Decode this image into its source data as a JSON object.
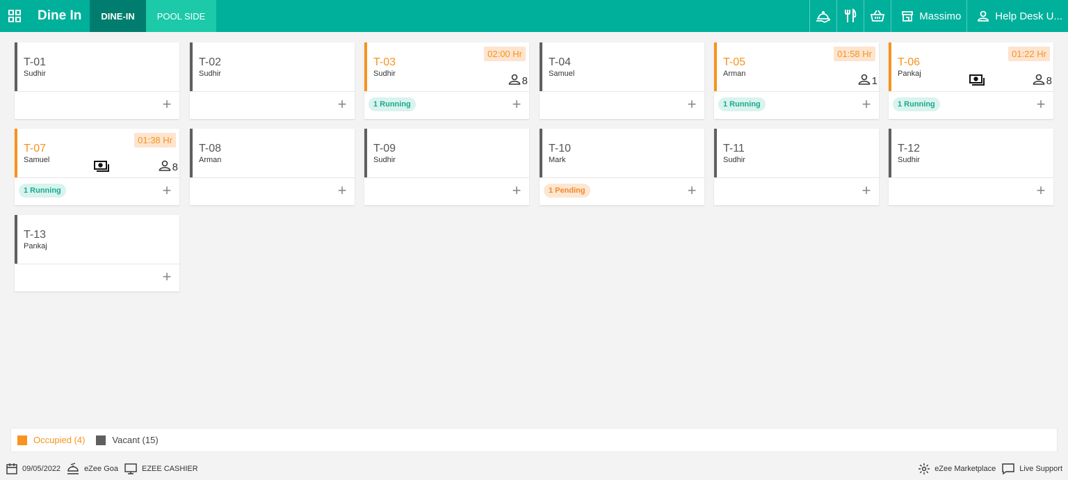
{
  "header": {
    "title": "Dine In",
    "tabs": [
      {
        "label": "DINE-IN",
        "active": true
      },
      {
        "label": "POOL SIDE",
        "active": false
      }
    ],
    "outlet": "Massimo",
    "user": "Help Desk U...",
    "icons": [
      "grid-icon",
      "serving-dish-icon",
      "cutlery-icon",
      "basket-icon",
      "store-icon",
      "user-icon"
    ],
    "color": "#00b09b"
  },
  "tables": [
    {
      "name": "T-01",
      "waiter": "Sudhir",
      "occupied": false,
      "timer": "",
      "pax": "",
      "cash": false,
      "status": "",
      "status_type": ""
    },
    {
      "name": "T-02",
      "waiter": "Sudhir",
      "occupied": false,
      "timer": "",
      "pax": "",
      "cash": false,
      "status": "",
      "status_type": ""
    },
    {
      "name": "T-03",
      "waiter": "Sudhir",
      "occupied": true,
      "timer": "02:00 Hr",
      "pax": "8",
      "cash": false,
      "status": "1 Running",
      "status_type": "running"
    },
    {
      "name": "T-04",
      "waiter": "Samuel",
      "occupied": false,
      "timer": "",
      "pax": "",
      "cash": false,
      "status": "",
      "status_type": ""
    },
    {
      "name": "T-05",
      "waiter": "Arman",
      "occupied": true,
      "timer": "01:58 Hr",
      "pax": "1",
      "cash": false,
      "status": "1 Running",
      "status_type": "running"
    },
    {
      "name": "T-06",
      "waiter": "Pankaj",
      "occupied": true,
      "timer": "01:22 Hr",
      "pax": "8",
      "cash": true,
      "status": "1 Running",
      "status_type": "running"
    },
    {
      "name": "T-07",
      "waiter": "Samuel",
      "occupied": true,
      "timer": "01:38 Hr",
      "pax": "8",
      "cash": true,
      "status": "1 Running",
      "status_type": "running"
    },
    {
      "name": "T-08",
      "waiter": "Arman",
      "occupied": false,
      "timer": "",
      "pax": "",
      "cash": false,
      "status": "",
      "status_type": ""
    },
    {
      "name": "T-09",
      "waiter": "Sudhir",
      "occupied": false,
      "timer": "",
      "pax": "",
      "cash": false,
      "status": "",
      "status_type": ""
    },
    {
      "name": "T-10",
      "waiter": "Mark",
      "occupied": false,
      "timer": "",
      "pax": "",
      "cash": false,
      "status": "1 Pending",
      "status_type": "pending"
    },
    {
      "name": "T-11",
      "waiter": "Sudhir",
      "occupied": false,
      "timer": "",
      "pax": "",
      "cash": false,
      "status": "",
      "status_type": ""
    },
    {
      "name": "T-12",
      "waiter": "Sudhir",
      "occupied": false,
      "timer": "",
      "pax": "",
      "cash": false,
      "status": "",
      "status_type": ""
    },
    {
      "name": "T-13",
      "waiter": "Pankaj",
      "occupied": false,
      "timer": "",
      "pax": "",
      "cash": false,
      "status": "",
      "status_type": ""
    }
  ],
  "add_symbol": "+",
  "legend": {
    "occupied": "Occupied (4)",
    "vacant": "Vacant (15)",
    "occupied_color": "#f7931e",
    "vacant_color": "#5f5f5f"
  },
  "footer": {
    "date": "09/05/2022",
    "property": "eZee Goa",
    "terminal": "EZEE CASHIER",
    "marketplace": "eZee Marketplace",
    "support": "Live Support"
  }
}
